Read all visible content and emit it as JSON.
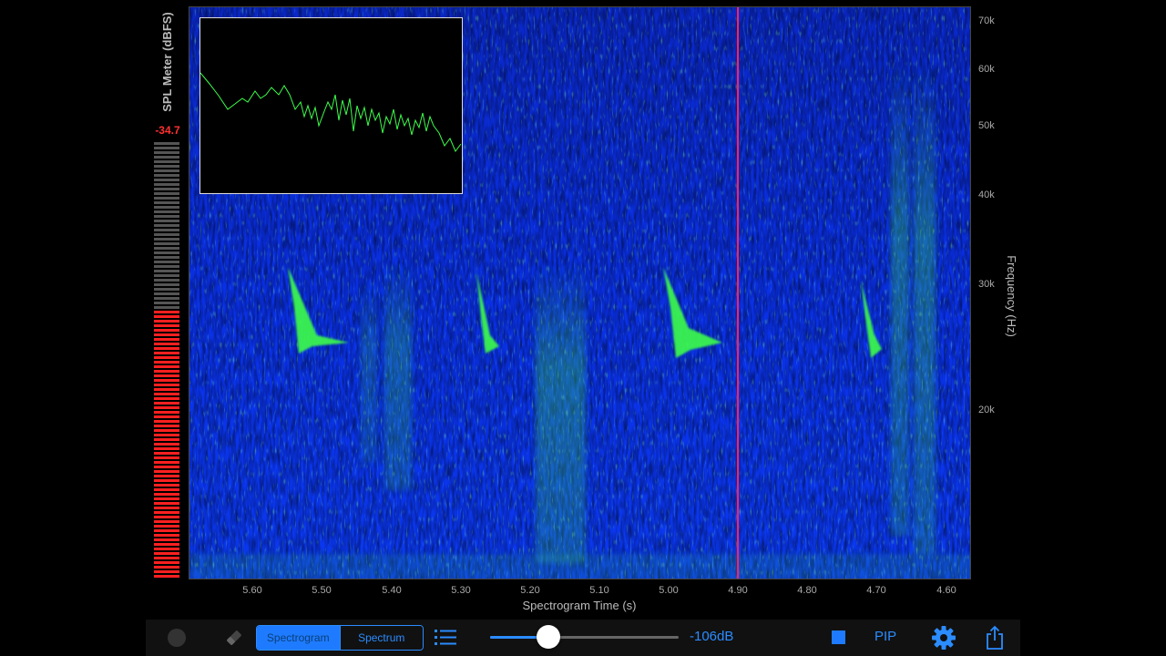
{
  "spl_meter": {
    "title": "SPL Meter (dBFS)",
    "value": "-34.7",
    "level_fraction": 0.62,
    "colors": {
      "active": "#ff2020",
      "inactive": "#555555"
    }
  },
  "spectrogram": {
    "x_axis_label": "Spectrogram Time (s)",
    "y_axis_label": "Frequency (Hz)",
    "x_ticks": [
      "5.60",
      "5.50",
      "5.40",
      "5.30",
      "5.20",
      "5.10",
      "5.00",
      "4.90",
      "4.80",
      "4.70",
      "4.60"
    ],
    "y_ticks": [
      "70k",
      "60k",
      "50k",
      "40k",
      "30k",
      "20k"
    ],
    "cursor_color": "#ff2060",
    "colors": {
      "background": "#0a2fe0",
      "signal": "#3cff4a"
    }
  },
  "inset_spectrum": {
    "line_color": "#3cff4a"
  },
  "toolbar": {
    "record_icon": "record-icon",
    "eraser_icon": "eraser-icon",
    "modes": [
      "Spectrogram",
      "Spectrum"
    ],
    "selected_mode": "Spectrogram",
    "list_icon": "list-icon",
    "gain_slider_fraction": 0.31,
    "gain_label": "-106dB",
    "stop_icon": "stop-icon",
    "pip_label": "PIP",
    "settings_icon": "gear-icon",
    "share_icon": "share-icon",
    "accent_color": "#2b8cff"
  }
}
